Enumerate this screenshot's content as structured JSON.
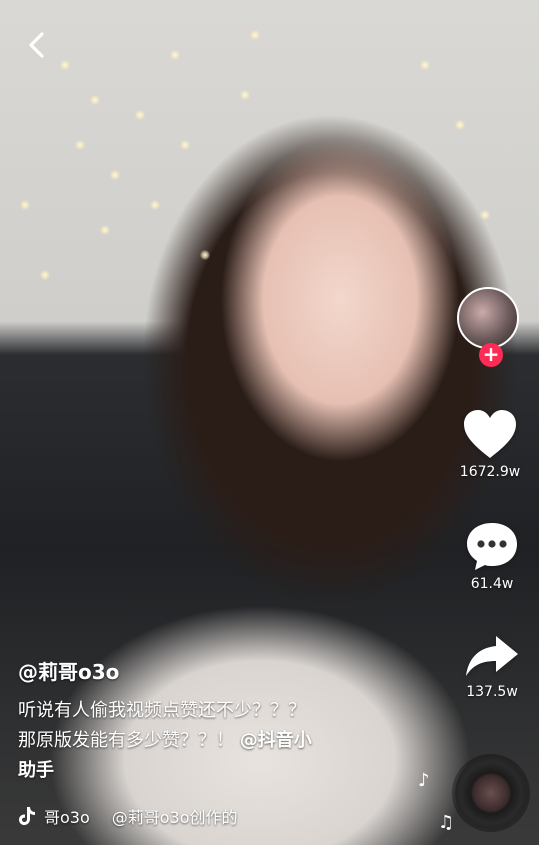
{
  "video": {
    "author": "@莉哥o3o",
    "caption_line1": "听说有人偷我视频点赞还不少？？？",
    "caption_line2": "那原版发能有多少赞？？！",
    "caption_mention": "@抖音小",
    "caption_line3": "助手",
    "music_account": "哥o3o",
    "music_title": "@莉哥o3o创作的"
  },
  "actions": {
    "likes": "1672.9w",
    "comments": "61.4w",
    "shares": "137.5w"
  },
  "colors": {
    "accent": "#fe2c55",
    "text": "#ffffff"
  },
  "icons": {
    "back": "chevron-left-icon",
    "like": "heart-icon",
    "comment": "comment-icon",
    "share": "share-arrow-icon",
    "music": "music-note-icon",
    "platform": "tiktok-logo-icon"
  }
}
